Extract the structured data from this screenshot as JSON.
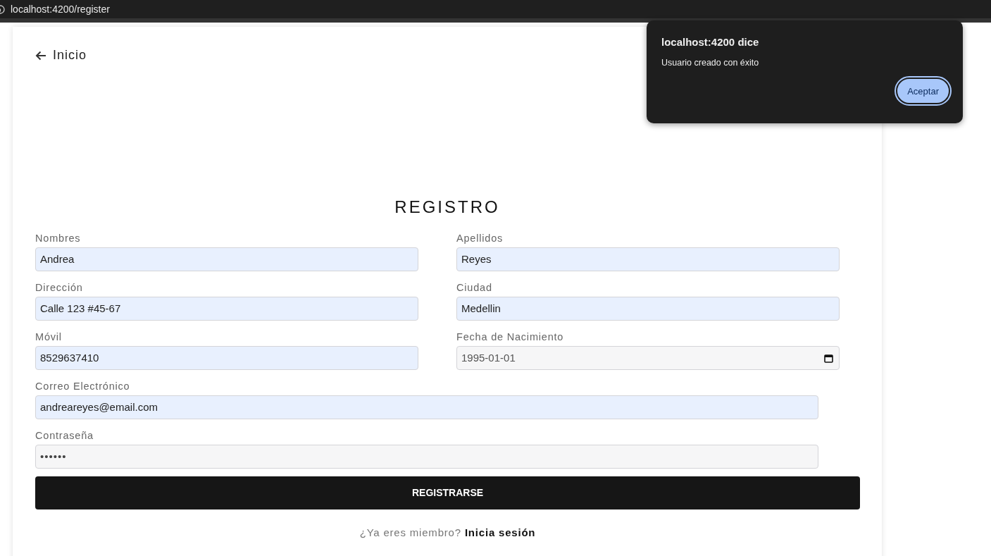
{
  "browser": {
    "url": "localhost:4200/register"
  },
  "back_link": {
    "label": "Inicio"
  },
  "form": {
    "title": "REGISTRO",
    "rows": [
      {
        "fields": [
          {
            "label": "Nombres",
            "value": "Andrea",
            "kind": "text",
            "autofilled": true
          },
          {
            "label": "Apellidos",
            "value": "Reyes",
            "kind": "text",
            "autofilled": true
          }
        ]
      },
      {
        "fields": [
          {
            "label": "Dirección",
            "value": "Calle 123 #45-67",
            "kind": "text",
            "autofilled": true
          },
          {
            "label": "Ciudad",
            "value": "Medellin",
            "kind": "text",
            "autofilled": true
          }
        ]
      },
      {
        "fields": [
          {
            "label": "Móvil",
            "value": "8529637410",
            "kind": "text",
            "autofilled": true
          },
          {
            "label": "Fecha de Nacimiento",
            "value": "1995-01-01",
            "kind": "date",
            "autofilled": false
          }
        ]
      },
      {
        "fields": [
          {
            "label": "Correo Electrónico",
            "value": "andreareyes@email.com",
            "kind": "text",
            "autofilled": true
          }
        ]
      },
      {
        "fields": [
          {
            "label": "Contraseña",
            "value": "••••••",
            "kind": "password",
            "autofilled": false
          }
        ]
      }
    ],
    "submit": "REGISTRARSE",
    "footer": {
      "prompt": "¿Ya eres miembro?",
      "link": "Inicia sesión"
    }
  },
  "dialog": {
    "title": "localhost:4200 dice",
    "message": "Usuario creado con éxito",
    "button": "Aceptar"
  }
}
